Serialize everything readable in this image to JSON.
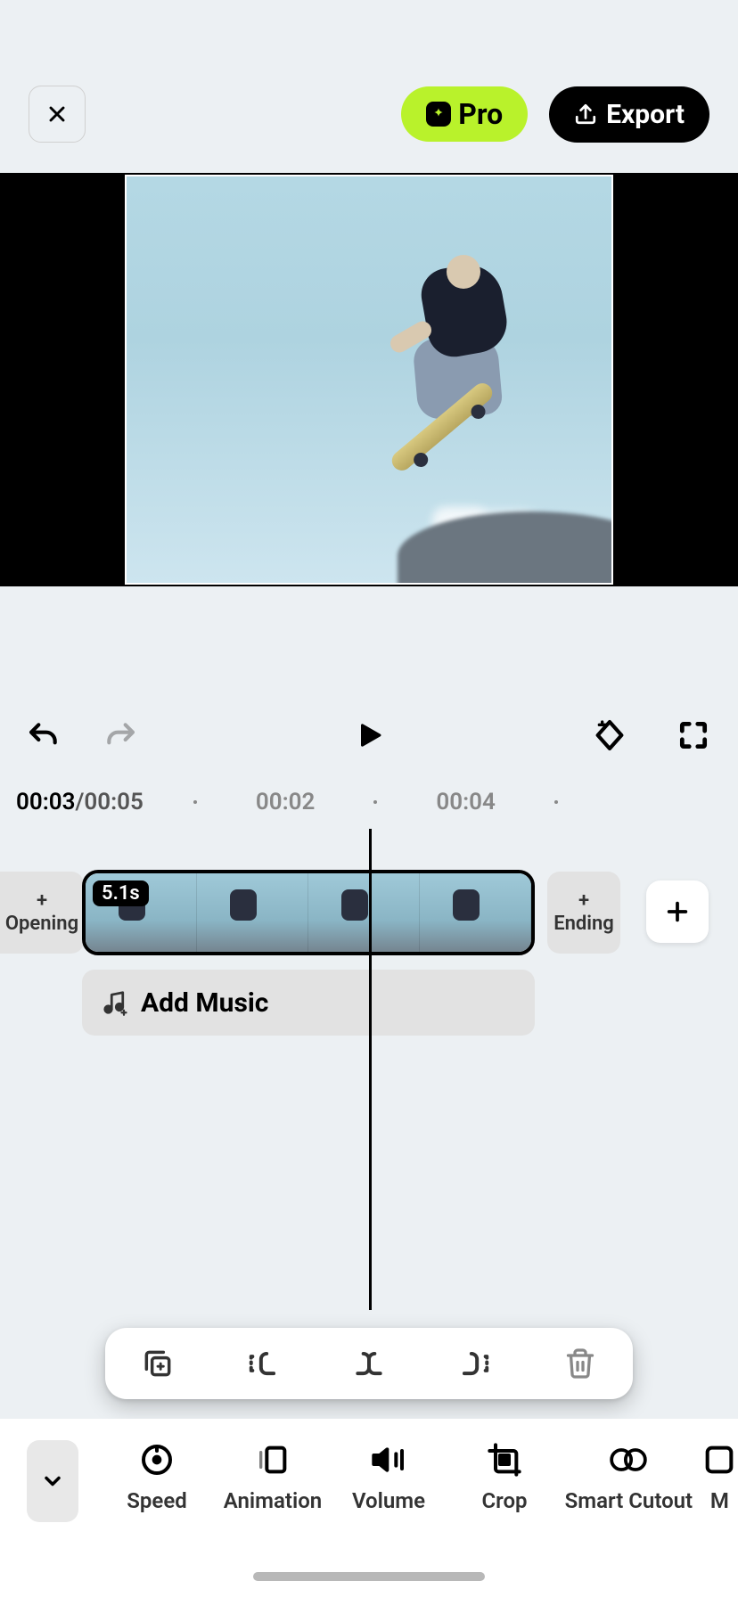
{
  "header": {
    "pro_label": "Pro",
    "export_label": "Export"
  },
  "playback": {
    "current_time": "00:03",
    "total_time": "00:05",
    "marker1": "00:02",
    "marker2": "00:04"
  },
  "timeline": {
    "opening_label": "Opening",
    "ending_label": "Ending",
    "clip_duration": "5.1s",
    "add_music_label": "Add Music"
  },
  "tools": {
    "items": [
      {
        "label": "Speed"
      },
      {
        "label": "Animation"
      },
      {
        "label": "Volume"
      },
      {
        "label": "Crop"
      },
      {
        "label": "Smart Cutout"
      },
      {
        "label": "M"
      }
    ]
  }
}
